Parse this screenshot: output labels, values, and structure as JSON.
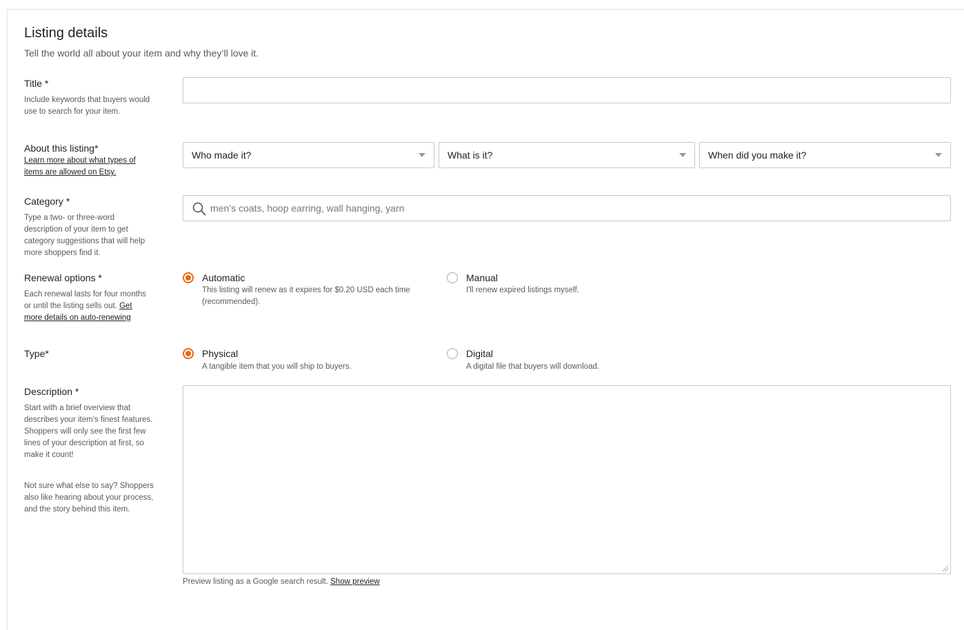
{
  "header": {
    "title": "Listing details",
    "subtitle": "Tell the world all about your item and why they’ll love it."
  },
  "title_field": {
    "label": "Title *",
    "help": "Include keywords that buyers would use to search for your item.",
    "value": ""
  },
  "about": {
    "label": "About this listing*",
    "link": "Learn more about what types of items are allowed on Etsy.",
    "selects": [
      {
        "value": "Who made it?"
      },
      {
        "value": "What is it?"
      },
      {
        "value": "When did you make it?"
      }
    ]
  },
  "category": {
    "label": "Category *",
    "help": "Type a two- or three-word description of your item to get category suggestions that will help more shoppers find it.",
    "placeholder": "men’s coats, hoop earring, wall hanging, yarn"
  },
  "renewal": {
    "label": "Renewal options *",
    "help": "Each renewal lasts for four months or until the listing sells out.",
    "help_link": "Get more details on auto-renewing",
    "options": [
      {
        "title": "Automatic",
        "desc": "This listing will renew as it expires for $0.20 USD each time (recommended).",
        "selected": true
      },
      {
        "title": "Manual",
        "desc": "I'll renew expired listings myself.",
        "selected": false
      }
    ]
  },
  "type": {
    "label": "Type*",
    "options": [
      {
        "title": "Physical",
        "desc": "A tangible item that you will ship to buyers.",
        "selected": true
      },
      {
        "title": "Digital",
        "desc": "A digital file that buyers will download.",
        "selected": false
      }
    ]
  },
  "description": {
    "label": "Description *",
    "help1": "Start with a brief overview that describes your item’s finest features. Shoppers will only see the first few lines of your description at first, so make it count!",
    "help2": "Not sure what else to say? Shoppers also like hearing about your process, and the story behind this item.",
    "value": ""
  },
  "footer": {
    "preview_text": "Preview listing as a Google search result.",
    "preview_link": "Show preview"
  },
  "colors": {
    "accent": "#e76811",
    "border": "#c8c8c8",
    "muted": "#595959"
  },
  "icons": {
    "search": "search-icon",
    "caret": "chevron-down-icon"
  }
}
